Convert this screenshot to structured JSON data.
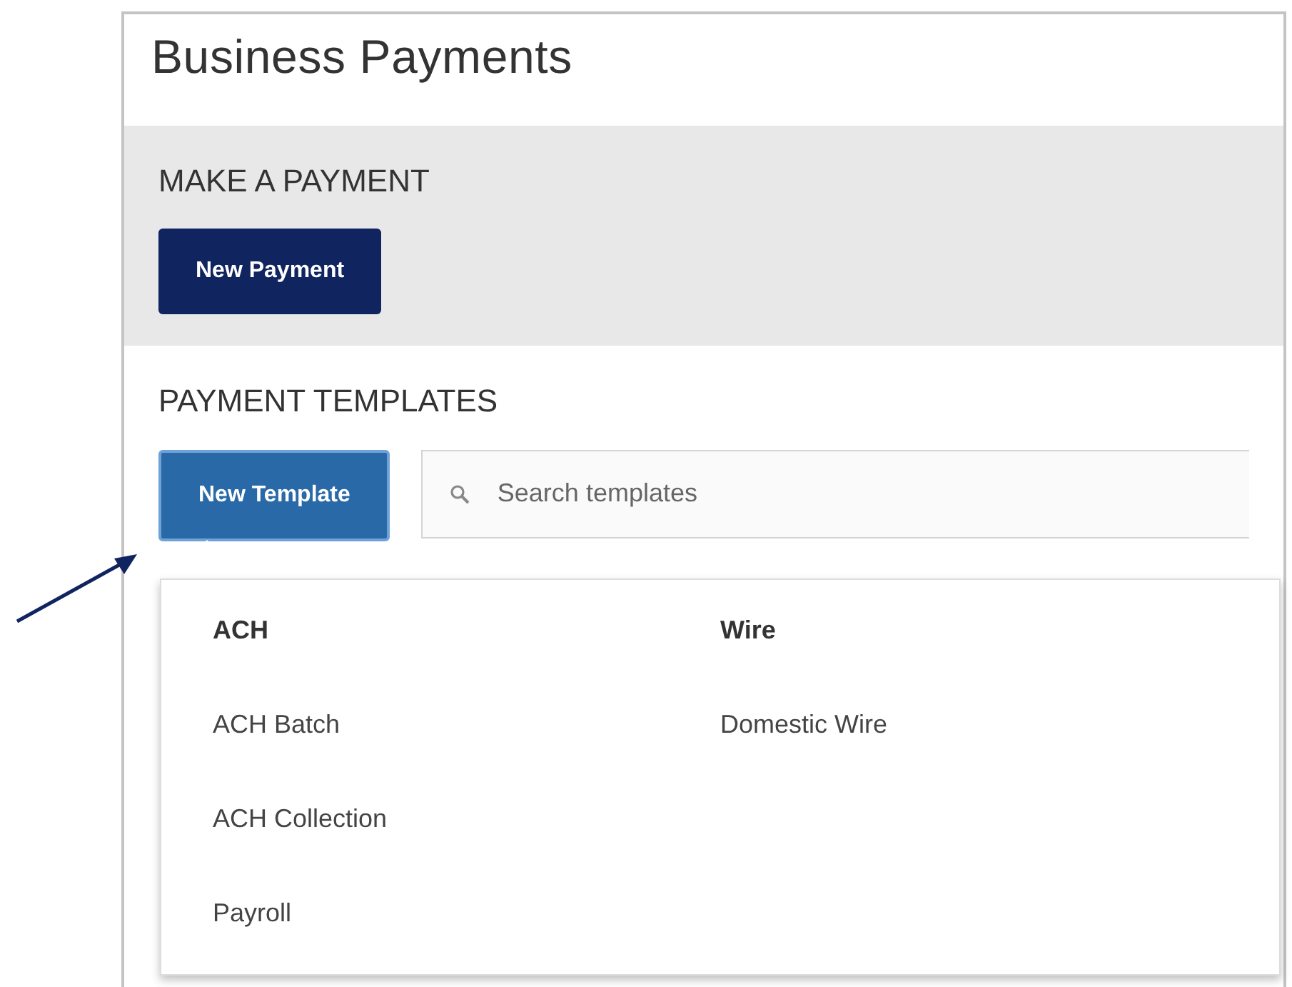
{
  "page": {
    "title": "Business Payments"
  },
  "make_payment": {
    "heading": "MAKE A PAYMENT",
    "button": "New Payment"
  },
  "templates": {
    "heading": "PAYMENT TEMPLATES",
    "new_button": "New Template",
    "menu_open": true,
    "search": {
      "placeholder": "Search templates"
    },
    "menu": [
      {
        "heading": "ACH",
        "items": [
          "ACH Batch",
          "ACH Collection",
          "Payroll"
        ]
      },
      {
        "heading": "Wire",
        "items": [
          "Domestic Wire"
        ]
      }
    ]
  }
}
